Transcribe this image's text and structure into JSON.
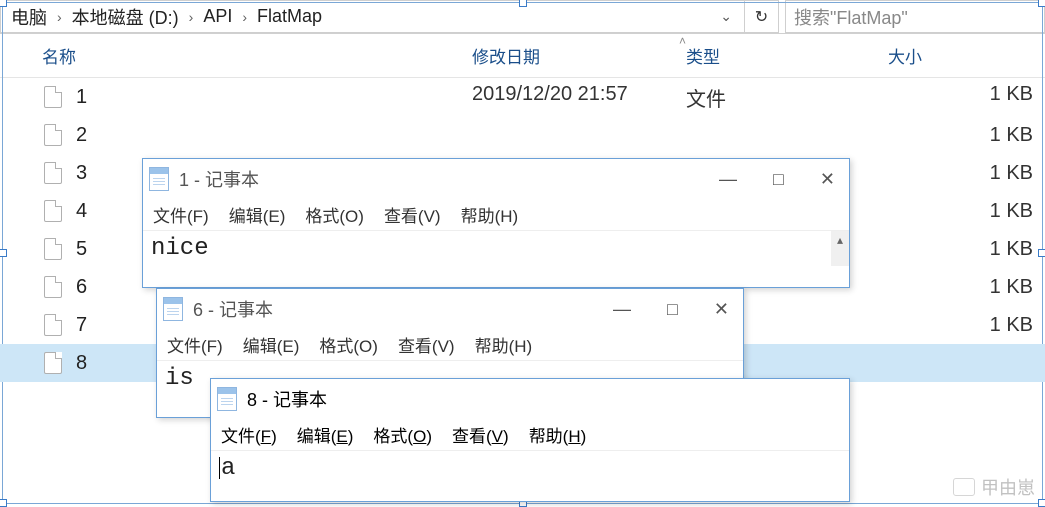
{
  "breadcrumb": {
    "items": [
      "电脑",
      "本地磁盘 (D:)",
      "API",
      "FlatMap"
    ]
  },
  "search": {
    "placeholder": "搜索\"FlatMap\""
  },
  "columns": {
    "name": "名称",
    "date": "修改日期",
    "type": "类型",
    "size": "大小"
  },
  "files": [
    {
      "name": "1",
      "date": "2019/12/20 21:57",
      "type": "文件",
      "size": "1 KB"
    },
    {
      "name": "2",
      "date": "",
      "type": "",
      "size": "1 KB"
    },
    {
      "name": "3",
      "date": "",
      "type": "",
      "size": "1 KB"
    },
    {
      "name": "4",
      "date": "",
      "type": "",
      "size": "1 KB"
    },
    {
      "name": "5",
      "date": "",
      "type": "",
      "size": "1 KB"
    },
    {
      "name": "6",
      "date": "",
      "type": "",
      "size": "1 KB"
    },
    {
      "name": "7",
      "date": "",
      "type": "",
      "size": "1 KB"
    },
    {
      "name": "8",
      "date": "",
      "type": "",
      "size": ""
    }
  ],
  "notepad_app_suffix": " - 记事本",
  "notepad_menus": {
    "file": "文件(F)",
    "edit": "编辑(E)",
    "format": "格式(O)",
    "view": "查看(V)",
    "help": "帮助(H)"
  },
  "notepad_menus_underlined": {
    "file": "文件(F)",
    "edit": "编辑(E)",
    "format": "格式(O)",
    "view": "查看(V)",
    "help": "帮助(H)"
  },
  "np1": {
    "title_num": "1",
    "content": "nice"
  },
  "np2": {
    "title_num": "6",
    "content": "is"
  },
  "np3": {
    "title_num": "8",
    "content": "a"
  },
  "watermark": "甲由崽"
}
